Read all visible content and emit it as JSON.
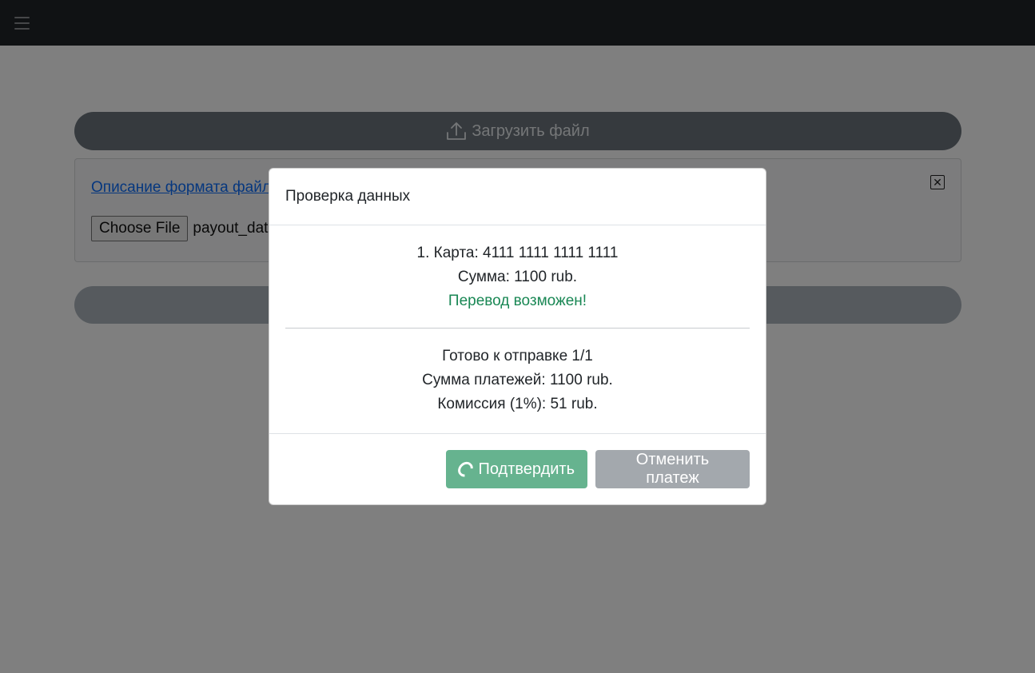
{
  "navbar": {
    "menu_icon": "hamburger-menu-icon"
  },
  "upload": {
    "label": "Загрузить файл",
    "icon": "upload-icon"
  },
  "file_panel": {
    "format_link": "Описание формата файла",
    "choose_file_label": "Choose File",
    "file_name": "payout_data.csv",
    "close_icon": "close-icon"
  },
  "modal": {
    "title": "Проверка данных",
    "entries": [
      {
        "card": "1. Карта: 4111 1111 1111 1111",
        "amount": "Сумма: 1100 rub.",
        "status": "Перевод возможен!"
      }
    ],
    "summary": {
      "ready": "Готово к отправке 1/1",
      "total": "Сумма платежей: 1100 rub.",
      "fee": "Комиссия (1%): 51 rub."
    },
    "confirm_label": "Подтвердить",
    "cancel_label": "Отменить платеж"
  },
  "colors": {
    "navbar": "#212529",
    "success": "#198754",
    "confirm_button": "#66b38f",
    "cancel_button": "#a3a8ad"
  }
}
